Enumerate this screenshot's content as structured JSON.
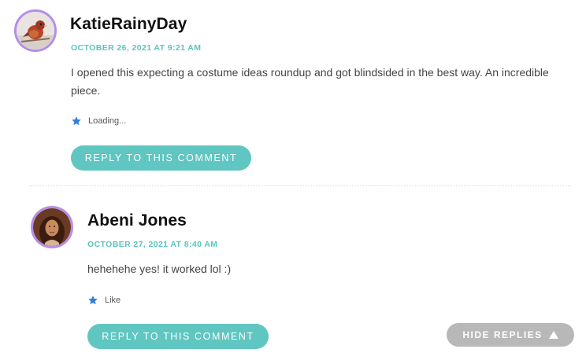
{
  "comments": [
    {
      "author": "KatieRainyDay",
      "date": "OCTOBER 26, 2021 AT 9:21 AM",
      "text": "I opened this expecting a costume ideas roundup and got blindsided in the best way. An incredible piece.",
      "like_label": "Loading...",
      "like_icon": "star-icon",
      "reply_label": "REPLY TO THIS COMMENT",
      "avatar_icon": "bird-avatar"
    },
    {
      "author": "Abeni Jones",
      "date": "OCTOBER 27, 2021 AT 8:40 AM",
      "text": "hehehehe yes! it worked lol :)",
      "like_label": "Like",
      "like_icon": "star-icon",
      "reply_label": "REPLY TO THIS COMMENT",
      "avatar_icon": "person-avatar"
    }
  ],
  "hide_replies_label": "HIDE REPLIES",
  "colors": {
    "accent": "#5fc6c1",
    "meta": "#5bc4bd",
    "avatar_ring": "#b48fe6",
    "star_blue": "#2f7fd6",
    "hide_bg": "#b8b8b8"
  }
}
